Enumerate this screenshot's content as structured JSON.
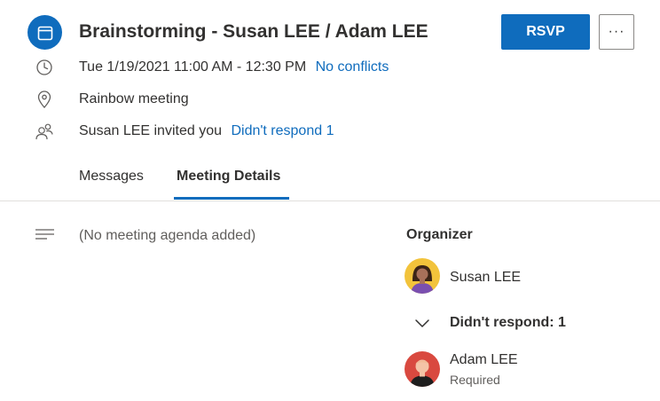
{
  "header": {
    "title": "Brainstorming - Susan LEE / Adam LEE",
    "rsvp_label": "RSVP",
    "more_label": "···",
    "icon": "calendar-icon",
    "accent": "#0f6cbd"
  },
  "details": {
    "time": "Tue 1/19/2021 11:00 AM - 12:30 PM",
    "conflicts": "No conflicts",
    "location": "Rainbow meeting",
    "invited": "Susan LEE invited you",
    "responses": "Didn't respond 1"
  },
  "tabs": [
    {
      "label": "Messages",
      "active": false
    },
    {
      "label": "Meeting Details",
      "active": true
    }
  ],
  "agenda": {
    "icon": "text-lines-icon",
    "text": "(No meeting agenda added)"
  },
  "attendees": {
    "organizer_heading": "Organizer",
    "organizer": {
      "name": "Susan LEE"
    },
    "group_heading": "Didn't respond: 1",
    "group_members": [
      {
        "name": "Adam LEE",
        "role": "Required"
      }
    ]
  }
}
